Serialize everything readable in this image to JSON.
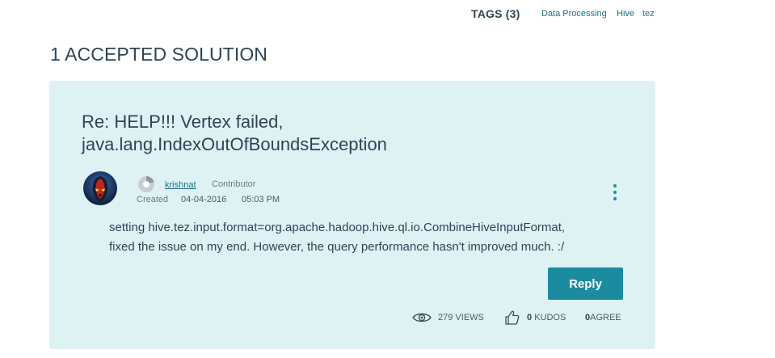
{
  "tags": {
    "title": "TAGS (3)",
    "items": [
      "Data Processing",
      "Hive",
      "tez"
    ]
  },
  "section_heading": "1 ACCEPTED SOLUTION",
  "post": {
    "title": "Re: HELP!!! Vertex failed, java.lang.IndexOutOfBoundsException",
    "author": {
      "name": "krishnat",
      "rank": "Contributor"
    },
    "created_label": "Created",
    "created_date": "04-04-2016",
    "created_time": "05:03 PM",
    "body_lines": [
      "setting hive.tez.input.format=org.apache.hadoop.hive.ql.io.CombineHiveInputFormat,",
      "fixed the issue on my end. However, the query performance hasn't improved much. :/"
    ],
    "reply_label": "Reply",
    "stats": {
      "views_count": "279",
      "views_label": "VIEWS",
      "kudos_count": "0",
      "kudos_label": "KUDOS",
      "agree_count": "0",
      "agree_label": "AGREE"
    }
  },
  "icons": {
    "avatar": "avatar-image",
    "rank": "rank-badge-icon",
    "options": "more-options-icon",
    "views": "eye-icon",
    "kudos": "thumbs-up-icon"
  },
  "colors": {
    "card_background": "#def2f4",
    "accent": "#1b8c9f",
    "link": "#1d6f82",
    "text": "#2f4454"
  }
}
